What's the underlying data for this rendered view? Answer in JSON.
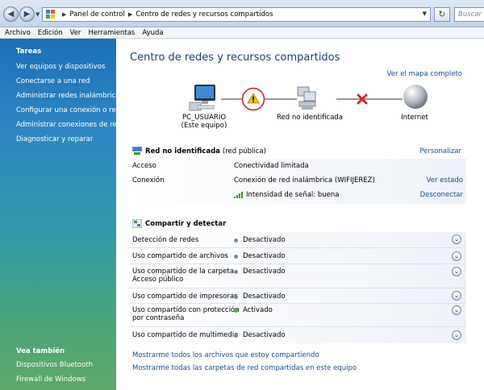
{
  "address_bar": {
    "breadcrumbs": [
      "Panel de control",
      "Centro de redes y recursos compartidos"
    ],
    "search_placeholder": "Buscar"
  },
  "menu": [
    "Archivo",
    "Edición",
    "Ver",
    "Herramientas",
    "Ayuda"
  ],
  "sidebar": {
    "tasks_title": "Tareas",
    "tasks": [
      "Ver equipos y dispositivos",
      "Conectarse a una red",
      "Administrar redes inalámbricas",
      "Configurar una conexión o red",
      "Administrar conexiones de red",
      "Diagnosticar y reparar"
    ],
    "see_also_title": "Vea también",
    "see_also": [
      "Dispositivos Bluetooth",
      "Firewall de Windows"
    ]
  },
  "main": {
    "title": "Centro de redes y recursos compartidos",
    "full_map_link": "Ver el mapa completo",
    "map": {
      "computer_name": "PC_USUARIO",
      "computer_sub": "(Este equipo)",
      "network_label": "Red no identificada",
      "internet_label": "Internet"
    },
    "network": {
      "name": "Red no identificada",
      "type": "(red pública)",
      "customize": "Personalizar",
      "rows": [
        {
          "label": "Acceso",
          "value": "Conectividad limitada",
          "action": ""
        },
        {
          "label": "Conexión",
          "value": "Conexión de red inalámbrica (WIFIJEREZ)",
          "action": "Ver estado"
        },
        {
          "label": "",
          "value": "Intensidad de señal: buena",
          "action": "Desconectar"
        }
      ]
    },
    "sharing": {
      "title": "Compartir y detectar",
      "rows": [
        {
          "label": "Detección de redes",
          "label2": "",
          "status": "Desactivado",
          "on": false
        },
        {
          "label": "Uso compartido de archivos",
          "label2": "",
          "status": "Desactivado",
          "on": false
        },
        {
          "label": "Uso compartido de la carpeta",
          "label2": "Acceso público",
          "status": "Desactivado",
          "on": false
        },
        {
          "label": "Uso compartido de impresoras",
          "label2": "",
          "status": "Desactivado",
          "on": false
        },
        {
          "label": "Uso compartido con protección",
          "label2": "por contraseña",
          "status": "Activado",
          "on": true
        },
        {
          "label": "Uso compartido de multimedia",
          "label2": "",
          "status": "Desactivado",
          "on": false
        }
      ]
    },
    "links": [
      "Mostrarme todos los archivos que estoy compartiendo",
      "Mostrarme todas las carpetas de red compartidas en este equipo"
    ]
  },
  "colors": {
    "link": "#1b4b99",
    "title": "#1d3e74",
    "warning_circle": "#d21f1f",
    "error_x": "#d32a2a",
    "status_on": "#3fb543",
    "status_off": "#7e8a96"
  }
}
